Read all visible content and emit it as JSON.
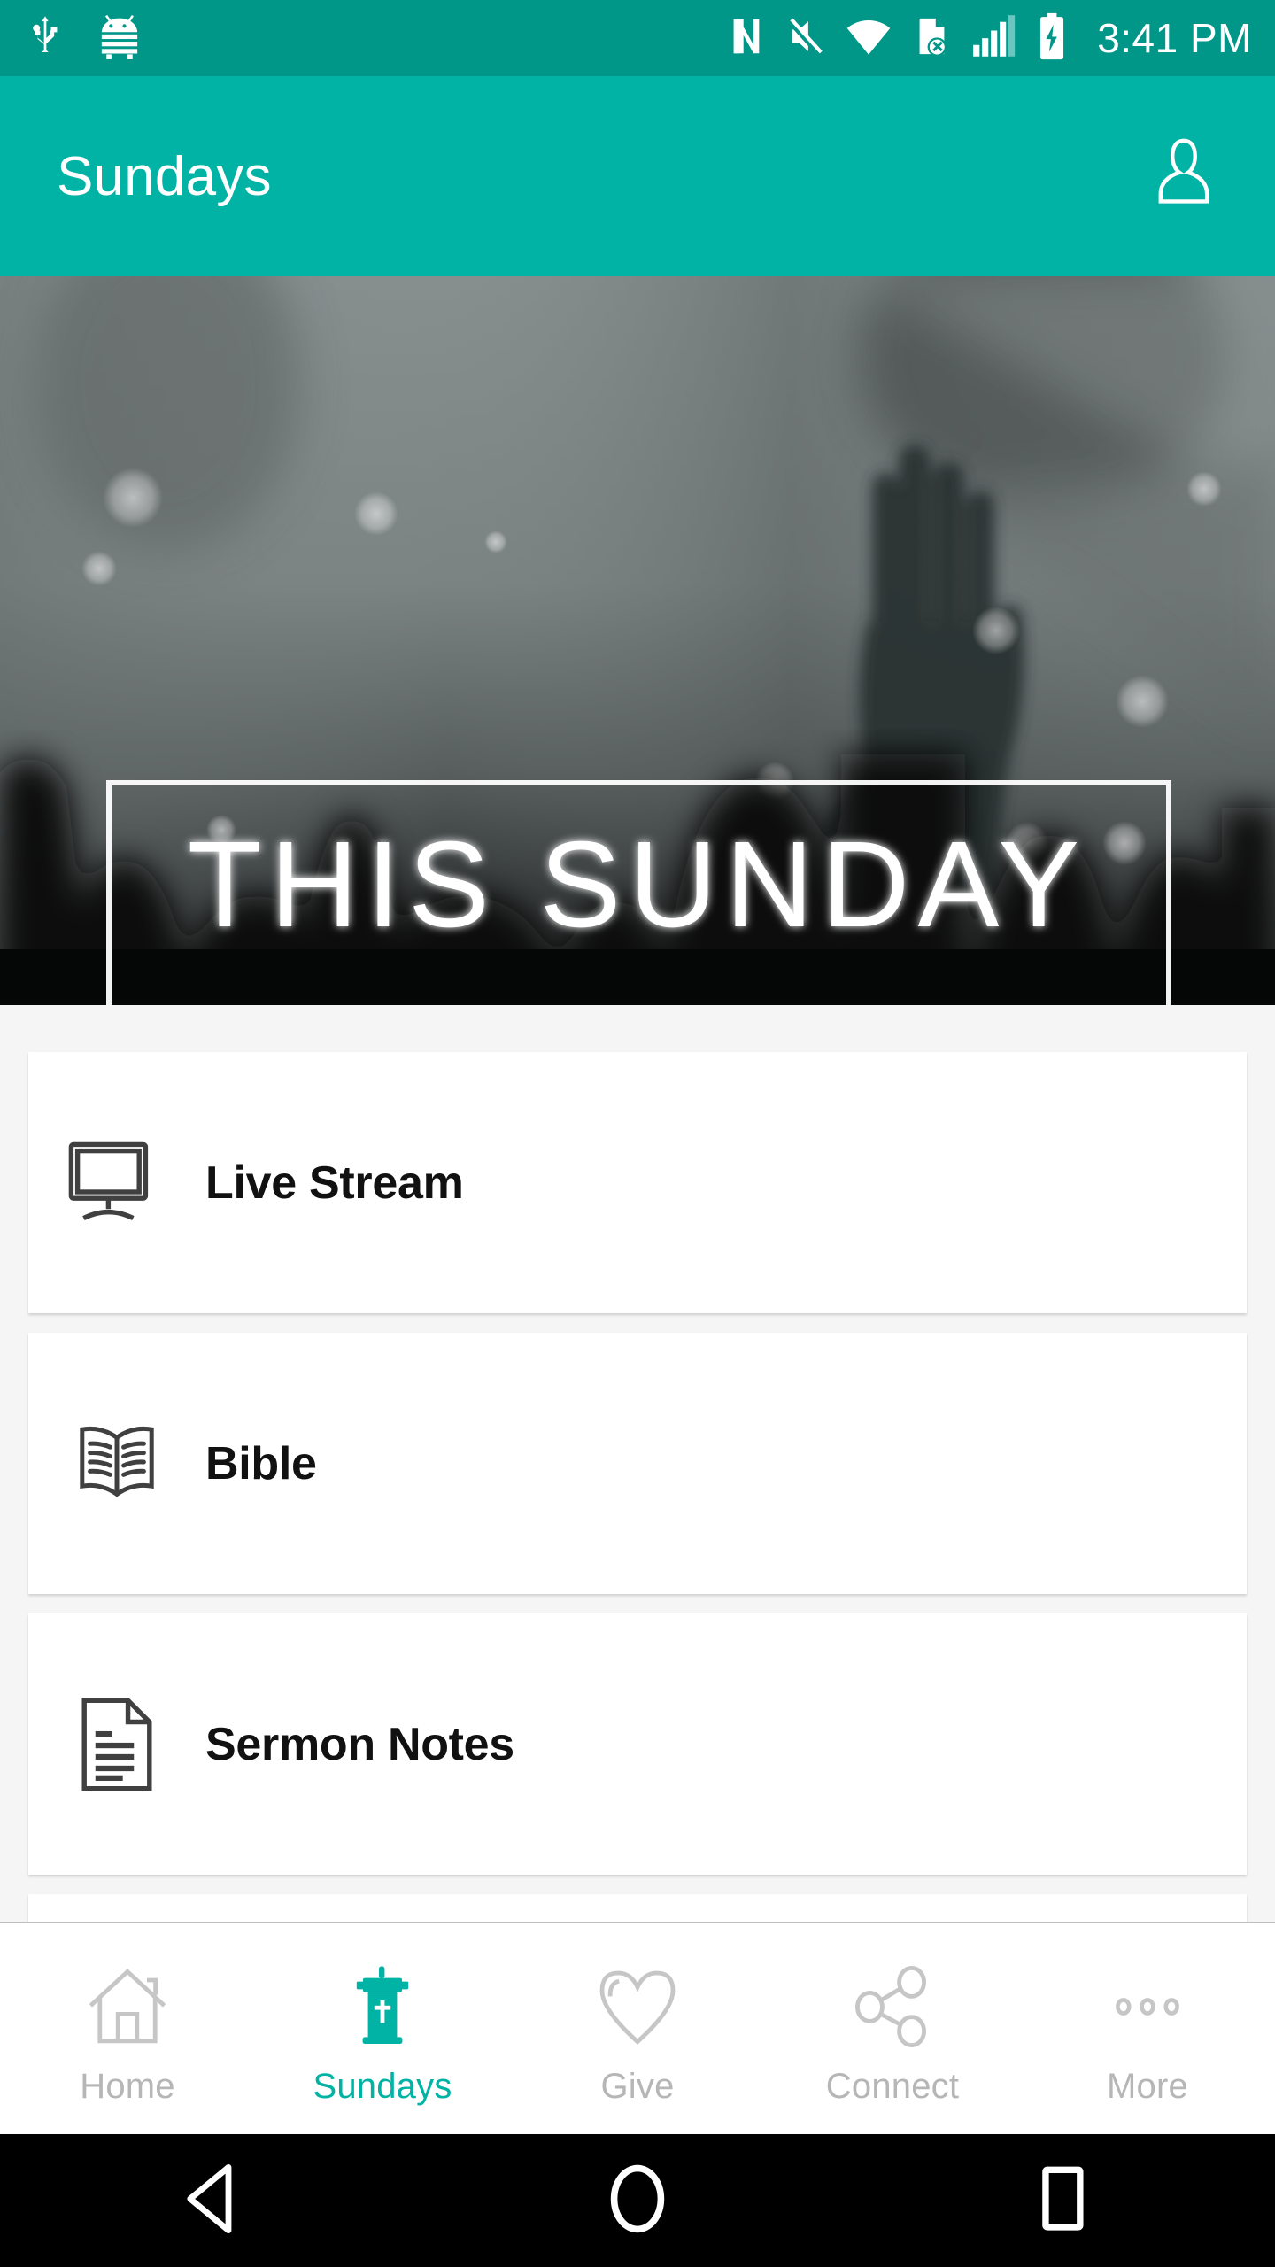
{
  "status_bar": {
    "background_color": "#009688",
    "time": "3:41 PM",
    "left_icons": [
      "usb-icon",
      "android-debug-icon"
    ],
    "right_icons": [
      "nfc-icon",
      "vibrate-mute-icon",
      "wifi-icon",
      "sim-error-icon",
      "cellular-signal-icon",
      "battery-charging-icon"
    ]
  },
  "app_bar": {
    "background_color": "#00b3a4",
    "title": "Sundays",
    "account_action": "account-icon"
  },
  "hero": {
    "banner_text": "THIS SUNDAY",
    "description": "Grayscale photo of a worship crowd with a raised hand silhouette and bokeh lights",
    "frame_color": "#ffffff"
  },
  "main": {
    "background_color": "#f5f5f5",
    "cards": [
      {
        "label": "Live Stream",
        "icon": "monitor-icon"
      },
      {
        "label": "Bible",
        "icon": "open-book-icon"
      },
      {
        "label": "Sermon Notes",
        "icon": "document-lines-icon"
      },
      {
        "label": "",
        "icon": ""
      }
    ]
  },
  "tab_bar": {
    "active_color": "#00b3a4",
    "inactive_color": "#b6b6b6",
    "tabs": [
      {
        "label": "Home",
        "icon": "home-icon",
        "active": false
      },
      {
        "label": "Sundays",
        "icon": "pulpit-cross-icon",
        "active": true
      },
      {
        "label": "Give",
        "icon": "heart-icon",
        "active": false
      },
      {
        "label": "Connect",
        "icon": "share-nodes-icon",
        "active": false
      },
      {
        "label": "More",
        "icon": "more-dots-icon",
        "active": false
      }
    ]
  },
  "android_nav": {
    "background_color": "#000000",
    "buttons": [
      {
        "name": "back-button",
        "icon": "triangle-back-icon"
      },
      {
        "name": "home-button",
        "icon": "circle-home-icon"
      },
      {
        "name": "recents-button",
        "icon": "square-recents-icon"
      }
    ]
  }
}
